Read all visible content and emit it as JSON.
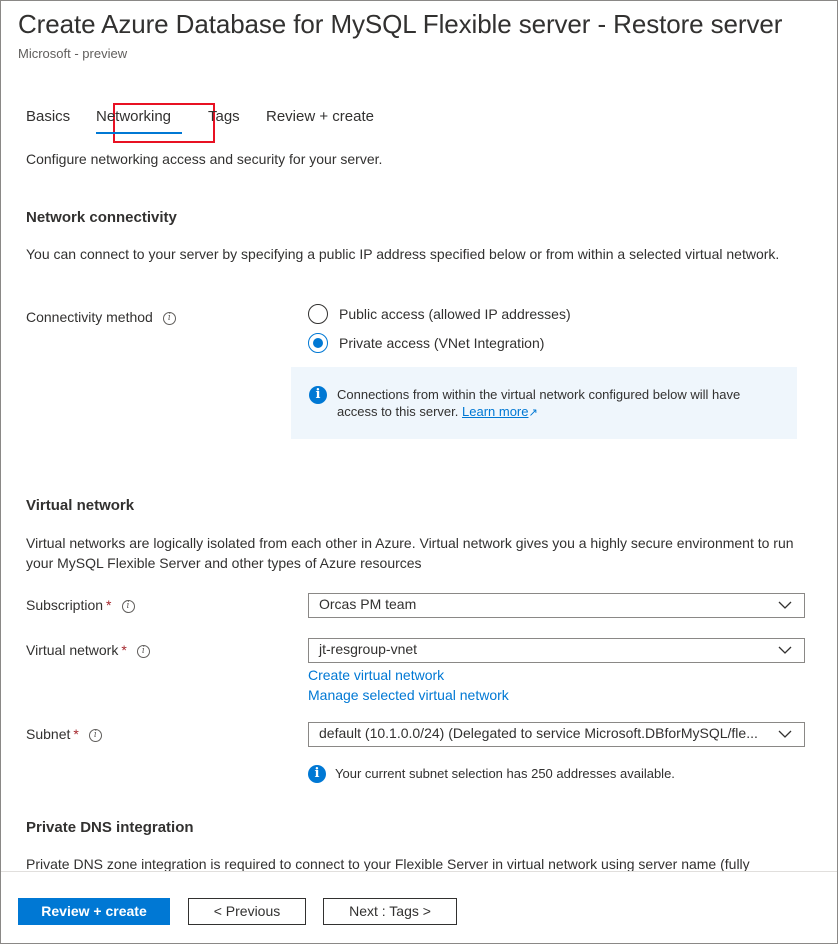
{
  "header": {
    "title": "Create Azure Database for MySQL Flexible server - Restore server",
    "subtitle": "Microsoft - preview"
  },
  "tabs": [
    {
      "label": "Basics",
      "active": false
    },
    {
      "label": "Networking",
      "active": true
    },
    {
      "label": "Tags",
      "active": false
    },
    {
      "label": "Review + create",
      "active": false
    }
  ],
  "intro": "Configure networking access and security for your server.",
  "network_connectivity": {
    "heading": "Network connectivity",
    "description": "You can connect to your server by specifying a public IP address specified below or from within a selected virtual network.",
    "method_label": "Connectivity method",
    "options": [
      {
        "label": "Public access (allowed IP addresses)",
        "selected": false
      },
      {
        "label": "Private access (VNet Integration)",
        "selected": true
      }
    ],
    "info": {
      "text": "Connections from within the virtual network configured below will have access to this server.",
      "link": "Learn more"
    }
  },
  "virtual_network": {
    "heading": "Virtual network",
    "description": "Virtual networks are logically isolated from each other in Azure. Virtual network gives you a highly secure environment to run your MySQL Flexible Server and other types of Azure resources",
    "subscription_label": "Subscription",
    "subscription_value": "Orcas PM team",
    "vnet_label": "Virtual network",
    "vnet_value": "jt-resgroup-vnet",
    "create_link": "Create virtual network",
    "manage_link": "Manage selected virtual network",
    "subnet_label": "Subnet",
    "subnet_value": "default (10.1.0.0/24) (Delegated to service Microsoft.DBforMySQL/fle...",
    "subnet_info": "Your current subnet selection has 250 addresses available.",
    "required_mark": "*"
  },
  "private_dns": {
    "heading": "Private DNS integration",
    "description": "Private DNS zone integration is required to connect to your Flexible Server in virtual network using server name (fully"
  },
  "footer": {
    "review_create": "Review + create",
    "previous": "< Previous",
    "next": "Next : Tags >"
  },
  "colors": {
    "accent": "#0078d4",
    "highlight_border": "#e81123",
    "required": "#a4262c",
    "info_bg": "#eff6fc"
  }
}
